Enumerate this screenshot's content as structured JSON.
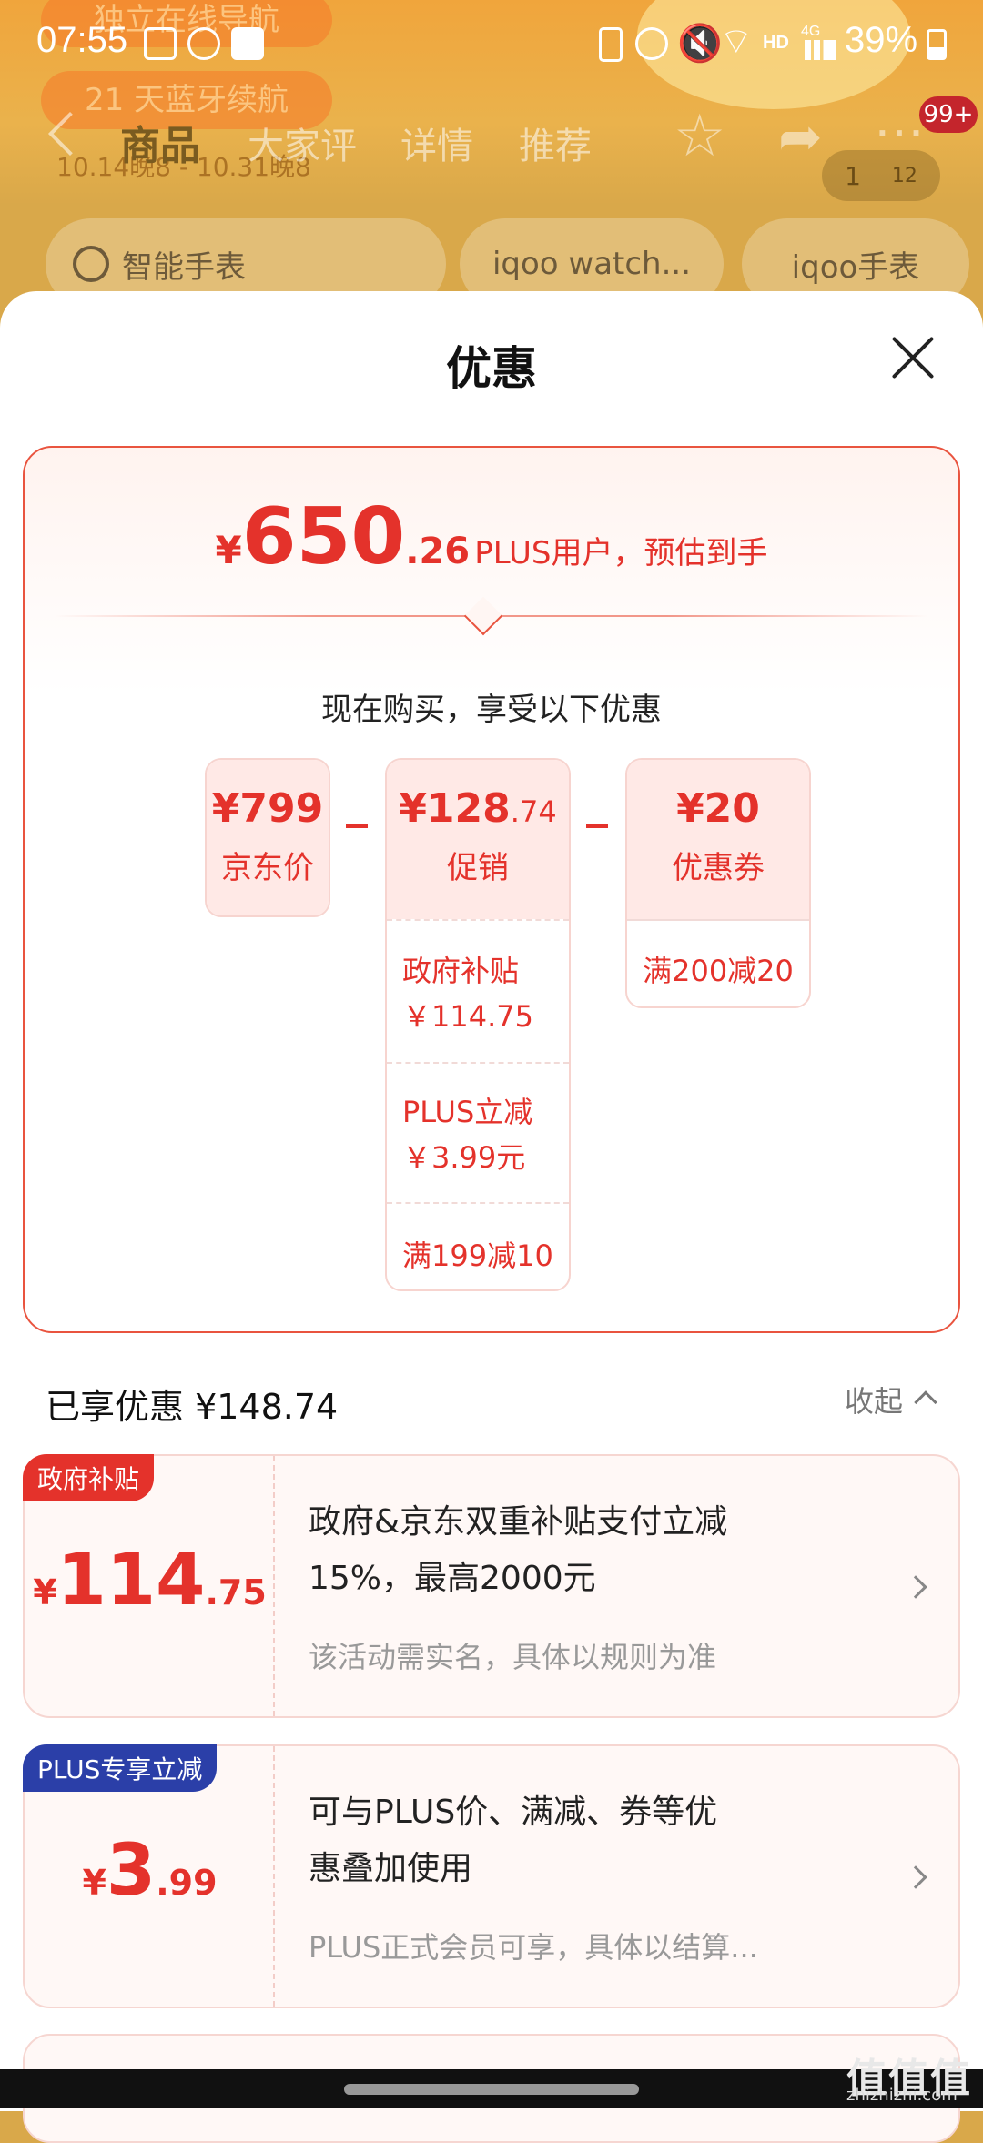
{
  "status_bar": {
    "time": "07:55",
    "battery": "39%",
    "network": "4G"
  },
  "background": {
    "ghost_pill_1": "独立在线导航",
    "ghost_pill_2": "21 天蓝牙续航",
    "ghost_date": "10.14晚8 - 10.31晚8",
    "nav_tabs": [
      "商品",
      "大家评",
      "详情",
      "推荐"
    ],
    "pager": {
      "current": "1",
      "total": "12"
    },
    "badge": "99+",
    "search_chips": [
      "智能手表",
      "iqoo watch...",
      "iqoo手表"
    ]
  },
  "sheet": {
    "title": "优惠"
  },
  "summary": {
    "currency": "¥",
    "price_int": "650",
    "price_dec": ".26",
    "price_label": "PLUS用户，预估到手",
    "buy_now_text": "现在购买，享受以下优惠",
    "jd_price": {
      "value": "¥799",
      "caption": "京东价"
    },
    "promo": {
      "value": "¥128",
      "value_dec": ".74",
      "caption": "促销",
      "rows": [
        {
          "name": "政府补贴",
          "amount": "￥114.75"
        },
        {
          "name": "PLUS立减",
          "amount": "￥3.99元"
        },
        {
          "name": "满199减10",
          "amount": ""
        }
      ]
    },
    "coupon": {
      "value": "¥20",
      "caption": "优惠券",
      "rows": [
        "满200减20"
      ]
    }
  },
  "savings": {
    "label": "已享优惠 ¥148.74",
    "collapse_label": "收起"
  },
  "discounts": [
    {
      "tag": "政府补贴",
      "tag_color": "#e4322b",
      "currency": "¥",
      "int": "114",
      "dec": ".75",
      "desc_line1": "政府&京东双重补贴支付立减",
      "desc_line2": "15%，最高2000元",
      "note": "该活动需实名，具体以规则为准"
    },
    {
      "tag": "PLUS专享立减",
      "tag_color": "#2b3fa8",
      "currency": "¥",
      "int": "3",
      "dec": ".99",
      "desc_line1": "可与PLUS价、满减、券等优",
      "desc_line2": "惠叠加使用",
      "note": "PLUS正式会员可享，具体以结算..."
    }
  ],
  "watermark": {
    "text": "值值值",
    "site": "zhizhizhi.com"
  },
  "colors": {
    "accent": "#e4322b",
    "plus_blue": "#2b3fa8"
  }
}
